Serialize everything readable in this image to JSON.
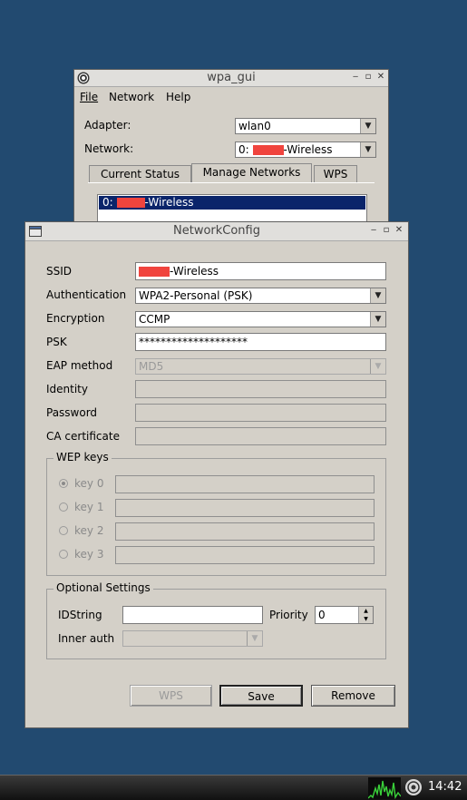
{
  "wpa_gui": {
    "title": "wpa_gui",
    "menu": [
      "File",
      "Network",
      "Help"
    ],
    "adapter_label": "Adapter:",
    "adapter_value": "wlan0",
    "network_label": "Network:",
    "network_prefix": "0: ",
    "network_suffix": "-Wireless",
    "tabs": [
      "Current Status",
      "Manage Networks",
      "WPS"
    ],
    "active_tab": "Manage Networks",
    "list_item_prefix": "0: ",
    "list_item_suffix": "-Wireless"
  },
  "network_config": {
    "title": "NetworkConfig",
    "labels": {
      "ssid": "SSID",
      "authentication": "Authentication",
      "encryption": "Encryption",
      "psk": "PSK",
      "eap_method": "EAP method",
      "identity": "Identity",
      "password": "Password",
      "ca_certificate": "CA certificate"
    },
    "values": {
      "ssid_suffix": "-Wireless",
      "authentication": "WPA2-Personal (PSK)",
      "encryption": "CCMP",
      "psk": "********************",
      "eap_method": "MD5",
      "identity": "",
      "password": "",
      "ca_certificate": ""
    },
    "wep_keys": {
      "title": "WEP keys",
      "keys": [
        "key 0",
        "key 1",
        "key 2",
        "key 3"
      ],
      "selected": "key 0"
    },
    "optional": {
      "title": "Optional Settings",
      "idstring_label": "IDString",
      "idstring_value": "",
      "priority_label": "Priority",
      "priority_value": "0",
      "inner_auth_label": "Inner auth",
      "inner_auth_value": ""
    },
    "buttons": {
      "wps": "WPS",
      "save": "Save",
      "remove": "Remove"
    }
  },
  "taskbar": {
    "clock": "14:42"
  },
  "colors": {
    "desktop": "#224a70",
    "selection": "#0a246a",
    "redaction": "#f0443e"
  }
}
